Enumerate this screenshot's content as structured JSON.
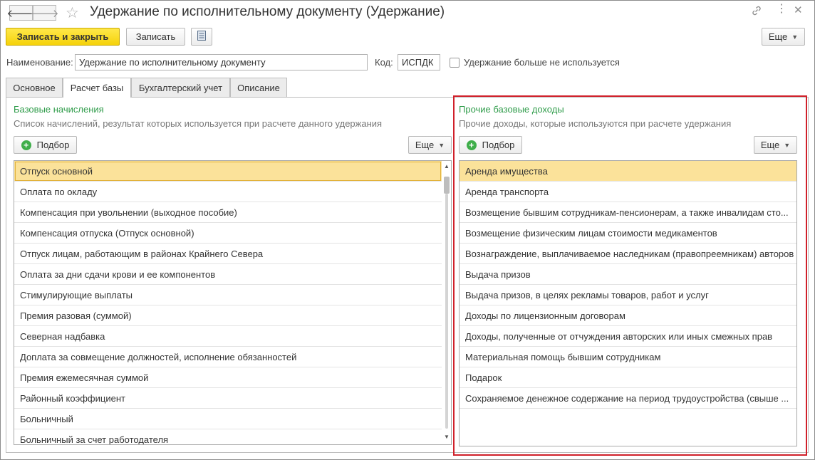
{
  "header": {
    "title": "Удержание по исполнительному документу (Удержание)",
    "back_icon": "arrow-left-icon",
    "forward_icon": "arrow-right-icon",
    "star_icon": "star-icon",
    "link_icon": "link-icon",
    "menu_icon": "kebab-menu-icon",
    "close_icon": "close-icon"
  },
  "toolbar": {
    "save_close_label": "Записать и закрыть",
    "save_label": "Записать",
    "more_label": "Еще"
  },
  "form": {
    "name_label": "Наименование:",
    "name_value": "Удержание по исполнительному документу",
    "code_label": "Код:",
    "code_value": "ИСПДК",
    "unused_label": "Удержание больше не используется",
    "unused_checked": false
  },
  "tabs": [
    {
      "label": "Основное",
      "active": false
    },
    {
      "label": "Расчет базы",
      "active": true
    },
    {
      "label": "Бухгалтерский учет",
      "active": false
    },
    {
      "label": "Описание",
      "active": false
    }
  ],
  "left": {
    "title": "Базовые начисления",
    "description": "Список начислений, результат которых используется при расчете данного удержания",
    "pick_label": "Подбор",
    "more_label": "Еще",
    "items": [
      "Отпуск основной",
      "Оплата по окладу",
      "Компенсация при увольнении (выходное пособие)",
      "Компенсация отпуска (Отпуск основной)",
      "Отпуск лицам, работающим в районах Крайнего Севера",
      "Оплата за дни сдачи крови и ее компонентов",
      "Стимулирующие выплаты",
      "Премия разовая (суммой)",
      "Северная надбавка",
      "Доплата за совмещение должностей, исполнение обязанностей",
      "Премия ежемесячная суммой",
      "Районный коэффициент",
      "Больничный",
      "Больничный за счет работодателя"
    ]
  },
  "right": {
    "title": "Прочие базовые доходы",
    "description": "Прочие доходы, которые используются при расчете удержания",
    "pick_label": "Подбор",
    "more_label": "Еще",
    "items": [
      "Аренда имущества",
      "Аренда транспорта",
      "Возмещение бывшим сотрудникам-пенсионерам, а также инвалидам сто...",
      "Возмещение физическим лицам стоимости медикаментов",
      "Вознаграждение, выплачиваемое наследникам (правопреемникам) авторов",
      "Выдача призов",
      "Выдача призов, в целях рекламы товаров, работ и услуг",
      "Доходы по лицензионным договорам",
      "Доходы, полученные от отчуждения авторских или иных смежных прав",
      "Материальная помощь бывшим сотрудникам",
      "Подарок",
      "Сохраняемое денежное содержание на период трудоустройства (свыше ..."
    ]
  },
  "colors": {
    "accent_yellow": "#f5d20a",
    "section_title_green": "#2f9c4a",
    "selection": "#fbe29a",
    "highlight_red": "#d0202a"
  }
}
